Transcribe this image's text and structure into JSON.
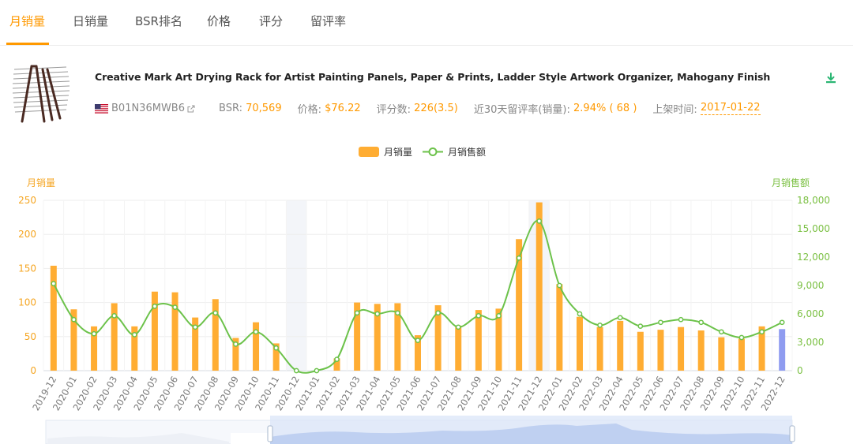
{
  "tabs": [
    {
      "label": "月销量",
      "active": true
    },
    {
      "label": "日销量",
      "active": false
    },
    {
      "label": "BSR排名",
      "active": false
    },
    {
      "label": "价格",
      "active": false
    },
    {
      "label": "评分",
      "active": false
    },
    {
      "label": "留评率",
      "active": false
    }
  ],
  "product": {
    "title": "Creative Mark Art Drying Rack for Artist Painting Panels, Paper & Prints, Ladder Style Artwork Organizer, Mahogany Finish",
    "asin": "B01N36MWB6",
    "flag_icon": "us-flag-icon",
    "bsr_label": "BSR:",
    "bsr_value": "70,569",
    "price_label": "价格:",
    "price_value": "$76.22",
    "reviews_label": "评分数:",
    "reviews_value": "226(3.5)",
    "review_rate_label": "近30天留评率(销量):",
    "review_rate_value": "2.94% ( 68 )",
    "listed_label": "上架时间:",
    "listed_value": "2017-01-22"
  },
  "colors": {
    "accent": "#ff9900",
    "bar": "#ffad33",
    "bar_highlight": "#8f9cf0",
    "line": "#6cc24a",
    "left_axis": "#f5a623",
    "right_axis": "#7bc043"
  },
  "chart_data": {
    "type": "bar",
    "legend": [
      "月销量",
      "月销售额"
    ],
    "legend_position": "top-center",
    "ylabel_left": "月销量",
    "ylabel_right": "月销售额",
    "ylim_left": [
      0,
      250
    ],
    "ylim_right": [
      0,
      18000
    ],
    "yticks_left": [
      "0",
      "50",
      "100",
      "150",
      "200",
      "250"
    ],
    "yticks_right": [
      "0",
      "3,000",
      "6,000",
      "9,000",
      "12,000",
      "15,000",
      "18,000"
    ],
    "grid": true,
    "categories": [
      "2019-12",
      "2020-01",
      "2020-02",
      "2020-03",
      "2020-04",
      "2020-05",
      "2020-06",
      "2020-07",
      "2020-08",
      "2020-09",
      "2020-10",
      "2020-11",
      "2020-12",
      "2021-01",
      "2021-02",
      "2021-03",
      "2021-04",
      "2021-05",
      "2021-06",
      "2021-07",
      "2021-08",
      "2021-09",
      "2021-10",
      "2021-11",
      "2021-12",
      "2022-01",
      "2022-02",
      "2022-03",
      "2022-04",
      "2022-05",
      "2022-06",
      "2022-07",
      "2022-08",
      "2022-09",
      "2022-10",
      "2022-11",
      "2022-12"
    ],
    "series": [
      {
        "name": "月销量",
        "type": "bar",
        "axis": "left",
        "values": [
          154,
          90,
          65,
          99,
          65,
          116,
          115,
          78,
          105,
          48,
          71,
          40,
          0,
          0,
          18,
          100,
          98,
          99,
          52,
          96,
          66,
          89,
          91,
          193,
          247,
          127,
          79,
          64,
          73,
          57,
          60,
          64,
          59,
          49,
          47,
          65,
          61
        ]
      },
      {
        "name": "月销售额",
        "type": "line",
        "axis": "right",
        "values": [
          9200,
          5400,
          3900,
          5800,
          3800,
          6800,
          6700,
          4600,
          6100,
          2800,
          4100,
          2400,
          0,
          0,
          1200,
          6100,
          6000,
          6100,
          3200,
          6100,
          4600,
          5800,
          5800,
          11900,
          15800,
          9000,
          6000,
          4800,
          5600,
          4700,
          5100,
          5400,
          5100,
          4100,
          3500,
          4100,
          5100
        ]
      }
    ]
  }
}
